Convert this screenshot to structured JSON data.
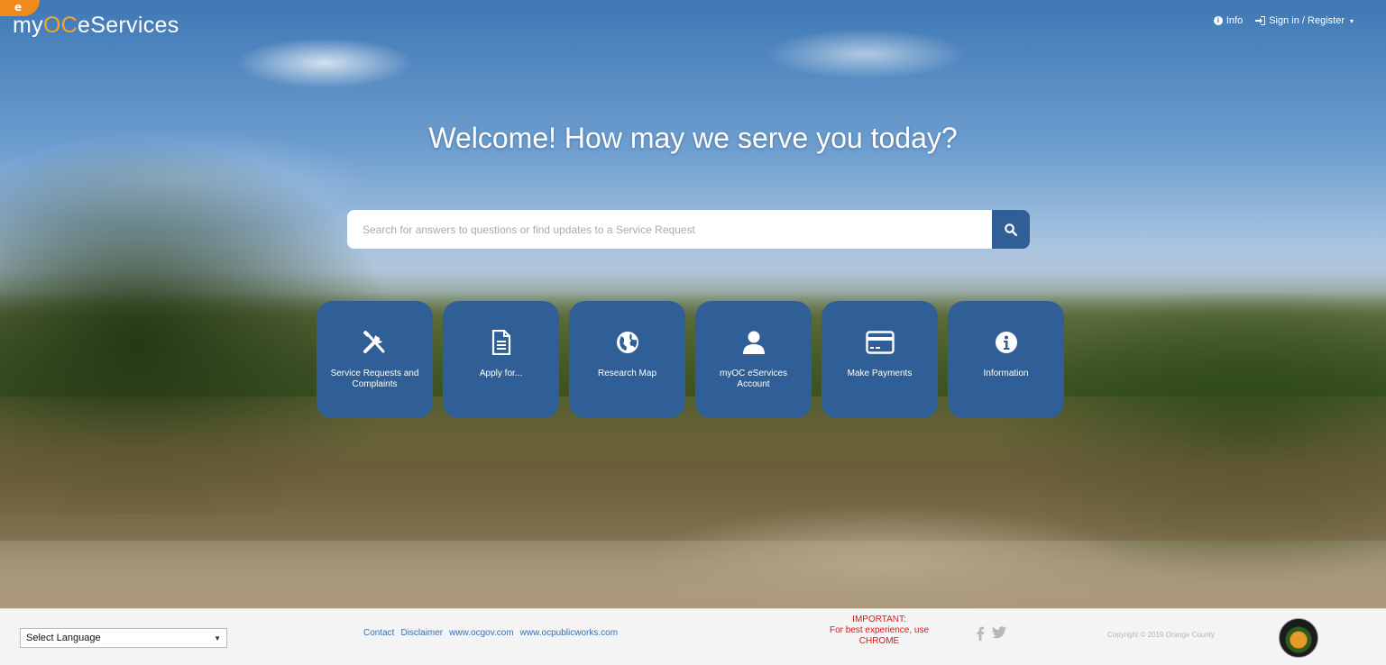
{
  "brand": {
    "prefix": "my",
    "oc": "OC",
    "suffix": "eServices",
    "corner_label": "e"
  },
  "topnav": {
    "info": "Info",
    "signin": "Sign in / Register"
  },
  "welcome": "Welcome! How may we serve you today?",
  "search": {
    "placeholder": "Search for answers to questions or find updates to a Service Request",
    "value": ""
  },
  "tiles": [
    {
      "label": "Service Requests and Complaints",
      "icon": "tools-icon"
    },
    {
      "label": "Apply for...",
      "icon": "document-icon"
    },
    {
      "label": "Research Map",
      "icon": "globe-icon"
    },
    {
      "label": "myOC eServices Account",
      "icon": "user-icon"
    },
    {
      "label": "Make Payments",
      "icon": "credit-card-icon"
    },
    {
      "label": "Information",
      "icon": "info-icon"
    }
  ],
  "footer": {
    "language": "Select Language",
    "links": [
      "Contact",
      "Disclaimer",
      "www.ocgov.com",
      "www.ocpublicworks.com"
    ],
    "important_title": "IMPORTANT:",
    "important_text": "For best experience, use CHROME",
    "social": {
      "facebook": "f",
      "twitter": "t"
    },
    "copyright": "Copyright © 2019 Orange County"
  },
  "colors": {
    "tile_blue": "#2f5f96",
    "brand_orange": "#f5a623",
    "important_red": "#e01414"
  }
}
